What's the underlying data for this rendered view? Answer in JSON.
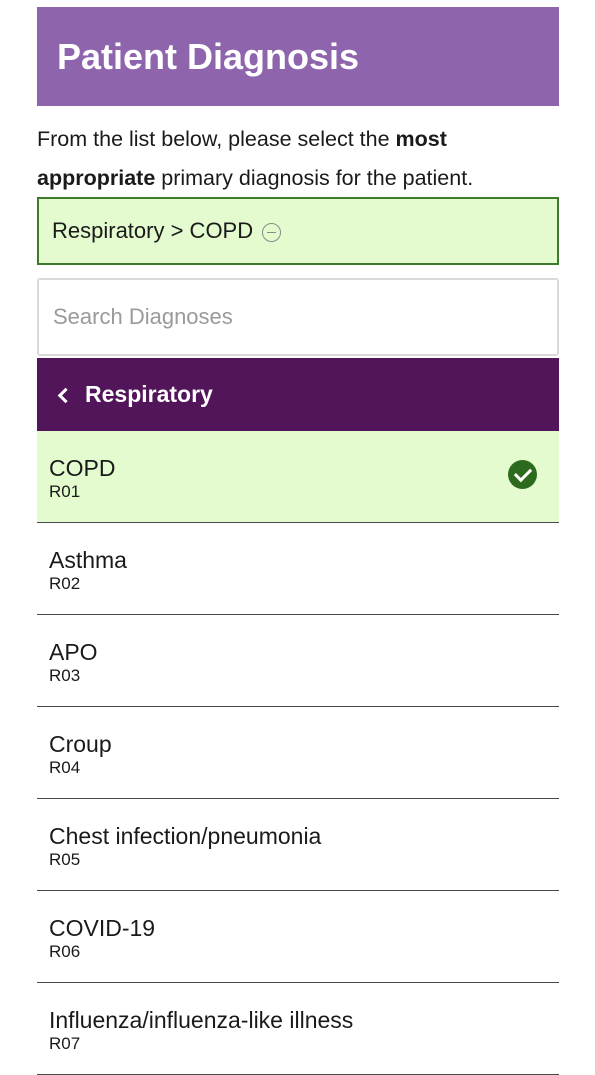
{
  "header": {
    "title": "Patient Diagnosis"
  },
  "intro": {
    "part1": "From the list below, please select the ",
    "bold1": "most",
    "bold2": "appropriate",
    "part2": " primary diagnosis for the patient."
  },
  "selection": {
    "path": "Respiratory > COPD",
    "remove_icon": "minus-circle-icon"
  },
  "search": {
    "placeholder": "Search Diagnoses",
    "value": ""
  },
  "category": {
    "label": "Respiratory",
    "back_icon": "chevron-left-icon"
  },
  "diagnoses": [
    {
      "name": "COPD",
      "code": "R01",
      "selected": true
    },
    {
      "name": "Asthma",
      "code": "R02",
      "selected": false
    },
    {
      "name": "APO",
      "code": "R03",
      "selected": false
    },
    {
      "name": "Croup",
      "code": "R04",
      "selected": false
    },
    {
      "name": "Chest infection/pneumonia",
      "code": "R05",
      "selected": false
    },
    {
      "name": "COVID-19",
      "code": "R06",
      "selected": false
    },
    {
      "name": "Influenza/influenza-like illness",
      "code": "R07",
      "selected": false
    }
  ],
  "colors": {
    "header_bg": "#8e65ad",
    "category_bg": "#521559",
    "selected_bg": "#e3fbcf",
    "selected_border": "#3d7a2c",
    "check_green": "#2c6b1e"
  }
}
